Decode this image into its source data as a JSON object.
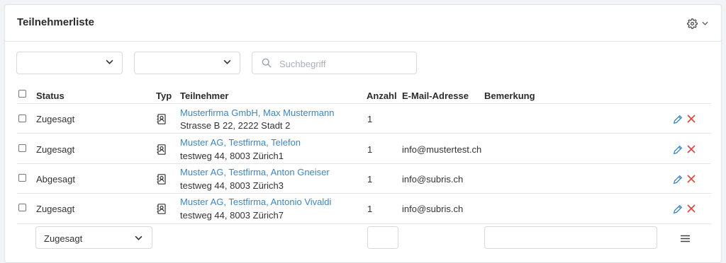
{
  "panel": {
    "title": "Teilnehmerliste",
    "gear_icon": "gear-icon"
  },
  "filters": {
    "select1_value": "",
    "select2_value": "",
    "search_placeholder": "Suchbegriff",
    "search_value": ""
  },
  "table": {
    "headers": {
      "status": "Status",
      "typ": "Typ",
      "teilnehmer": "Teilnehmer",
      "anzahl": "Anzahl",
      "email": "E-Mail-Adresse",
      "bemerkung": "Bemerkung"
    },
    "rows": [
      {
        "status": "Zugesagt",
        "name": "Musterfirma GmbH, Max Mustermann",
        "address": "Strasse B 22, 2222 Stadt 2",
        "anzahl": "1",
        "email": "",
        "bemerkung": ""
      },
      {
        "status": "Zugesagt",
        "name": "Muster AG, Testfirma, Telefon",
        "address": "testweg 44, 8003 Zürich1",
        "anzahl": "1",
        "email": "info@mustertest.ch",
        "bemerkung": ""
      },
      {
        "status": "Abgesagt",
        "name": "Muster AG, Testfirma, Anton Gneiser",
        "address": "testweg 44, 8003 Zürich3",
        "anzahl": "1",
        "email": "info@subris.ch",
        "bemerkung": ""
      },
      {
        "status": "Zugesagt",
        "name": "Muster AG, Testfirma, Antonio Vivaldi",
        "address": "testweg 44, 8003 Zürich7",
        "anzahl": "1",
        "email": "info@subris.ch",
        "bemerkung": ""
      }
    ]
  },
  "footer": {
    "status_select_value": "Zugesagt",
    "anzahl_value": "",
    "bemerkung_value": ""
  },
  "colors": {
    "link": "#3a86c8",
    "delete": "#e0413a",
    "edit": "#3a86c8"
  }
}
